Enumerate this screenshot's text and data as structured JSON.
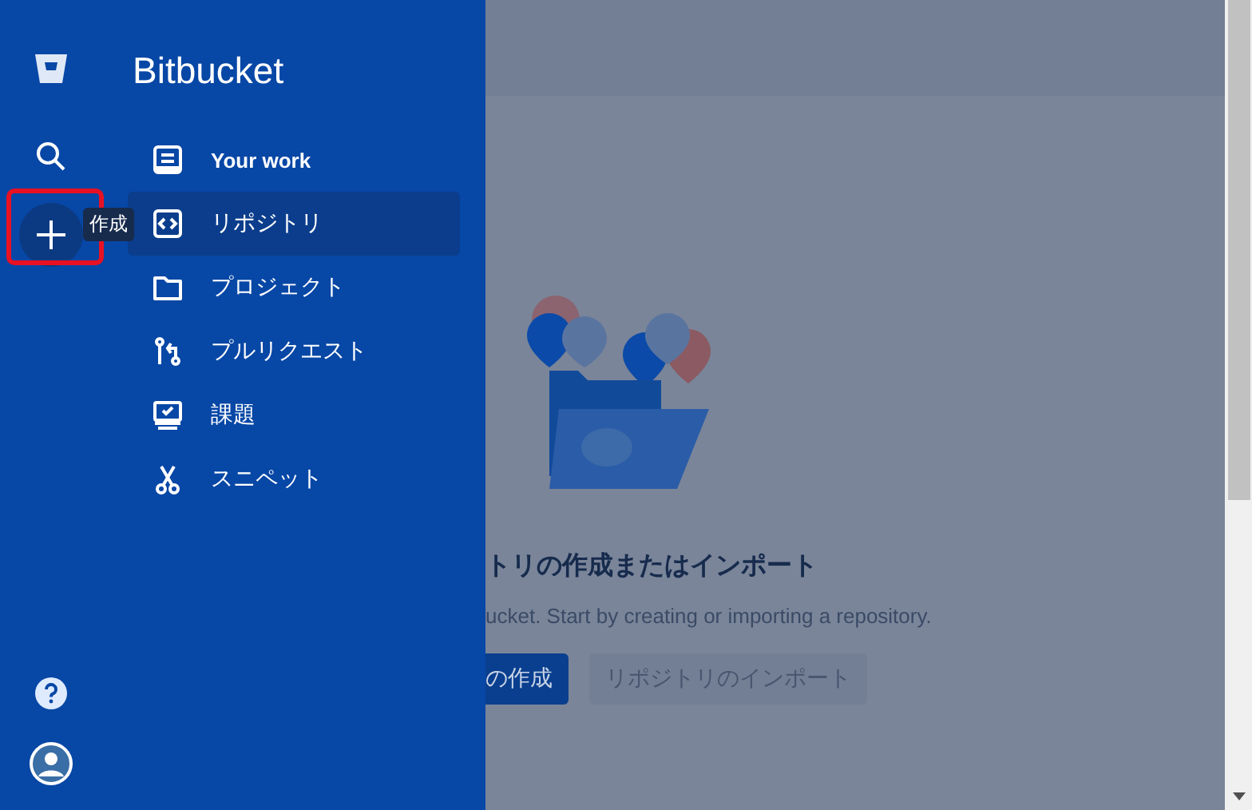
{
  "sidebar": {
    "brand": "Bitbucket",
    "create_tooltip": "作成",
    "create_highlighted": true,
    "nav": [
      {
        "label": "Your work",
        "kind": "work",
        "selected": false
      },
      {
        "label": "リポジトリ",
        "kind": "repo",
        "selected": true
      },
      {
        "label": "プロジェクト",
        "kind": "folder",
        "selected": false
      },
      {
        "label": "プルリクエスト",
        "kind": "pr",
        "selected": false
      },
      {
        "label": "課題",
        "kind": "issue",
        "selected": false
      },
      {
        "label": "スニペット",
        "kind": "snippet",
        "selected": false
      }
    ]
  },
  "main": {
    "title": "トリの作成またはインポート",
    "description": "ucket. Start by creating or importing a repository.",
    "buttons": [
      {
        "label": "の作成",
        "kind": "primary"
      },
      {
        "label": "リポジトリのインポート",
        "kind": "secondary"
      }
    ]
  }
}
